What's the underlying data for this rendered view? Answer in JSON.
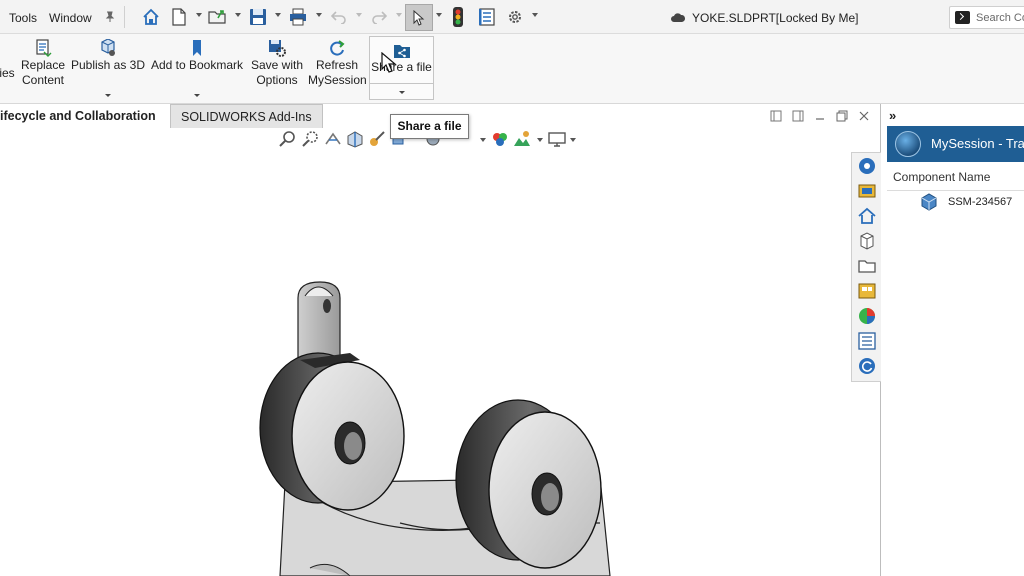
{
  "menu": {
    "tools": "Tools",
    "window": "Window"
  },
  "document": {
    "title": "YOKE.SLDPRT[Locked By Me]"
  },
  "search": {
    "placeholder": "Search Co"
  },
  "ribbon": {
    "left_clip": "ies",
    "replace_content": "Replace\nContent",
    "publish_3d": "Publish as 3D",
    "add_bookmark": "Add to Bookmark",
    "save_with_options": "Save with\nOptions",
    "refresh_mysession": "Refresh\nMySession",
    "share_file": "Share a file"
  },
  "tabs": {
    "active": "ifecycle and Collaboration",
    "addins": "SOLIDWORKS Add-Ins"
  },
  "tooltip": {
    "text": "Share a file"
  },
  "task_pane": {
    "collapse": "»",
    "title": "MySession - Tra",
    "column_header": "Component Name",
    "items": [
      {
        "label": "SSM-234567"
      }
    ]
  },
  "icons": {
    "quick_access": [
      "pin-icon",
      "home-icon",
      "new-document-icon",
      "open-folder-icon",
      "save-icon",
      "print-icon",
      "undo-icon",
      "redo-icon",
      "select-cursor-icon",
      "traffic-light-icon",
      "file-properties-icon",
      "options-gear-icon"
    ],
    "task_pane_tabs": [
      "solidworks-resources-icon",
      "design-library-icon",
      "home-icon",
      "part-icon",
      "file-explorer-icon",
      "view-palette-icon",
      "appearances-icon",
      "custom-properties-icon",
      "refresh-session-icon"
    ]
  },
  "colors": {
    "pane_header": "#1f5e94",
    "accent_blue": "#2a6ebb",
    "selected_button": "#c9c9c9"
  }
}
